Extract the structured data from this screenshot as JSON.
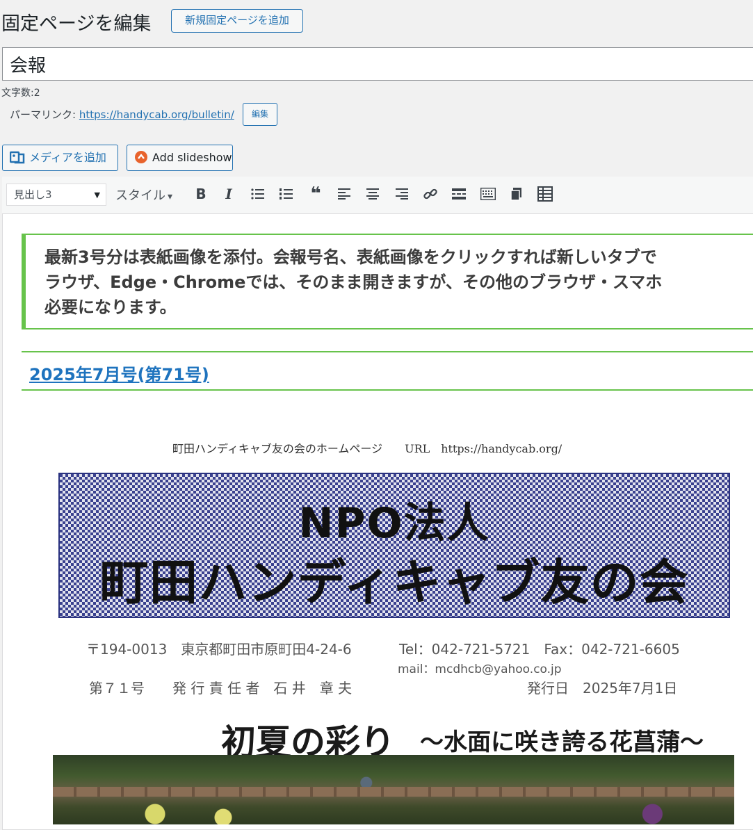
{
  "header": {
    "title": "固定ページを編集",
    "add_new_label": "新規固定ページを追加"
  },
  "post": {
    "title_value": "会報",
    "char_count": "文字数:2",
    "permalink_label": "パーマリンク:",
    "permalink_url": "https://handycab.org/bulletin/",
    "permalink_edit_label": "編集"
  },
  "media_buttons": {
    "add_media": "メディアを追加",
    "add_slideshow": "Add slideshow"
  },
  "toolbar": {
    "format_value": "見出し3",
    "styles_label": "スタイル",
    "styles_caret": "▾",
    "format_caret": "▼",
    "buttons": [
      {
        "name": "bold-button",
        "glyph": "B"
      },
      {
        "name": "italic-button",
        "glyph": "I"
      },
      {
        "name": "bullet-list-button",
        "icon": "bullet-list-icon"
      },
      {
        "name": "numbered-list-button",
        "icon": "numbered-list-icon"
      },
      {
        "name": "blockquote-button",
        "glyph": "❝"
      },
      {
        "name": "align-left-button",
        "icon": "align-left-icon"
      },
      {
        "name": "align-center-button",
        "icon": "align-center-icon"
      },
      {
        "name": "align-right-button",
        "icon": "align-right-icon"
      },
      {
        "name": "link-button",
        "icon": "link-icon"
      },
      {
        "name": "read-more-button",
        "icon": "read-more-icon"
      },
      {
        "name": "toolbar-toggle-button",
        "icon": "keyboard-icon"
      },
      {
        "name": "copy-button",
        "icon": "copy-icon"
      },
      {
        "name": "table-button",
        "icon": "table-icon"
      }
    ]
  },
  "content": {
    "notice_text": "最新3号分は表紙画像を添付。会報号名、表紙画像をクリックすれば新しいタブで\nラウザ、Edge・Chromeでは、そのまま開きますが、その他のブラウザ・スマホ\n必要になります。",
    "issue_link": "2025年7月号(第71号)"
  },
  "cover": {
    "header_line": "町田ハンディキャブ友の会のホームページ　　URL　https://handycab.org/",
    "masthead_line1": "NPO法人",
    "masthead_line2": "町田ハンディキャブ友の会",
    "address": "〒194-0013　東京都町田市原町田4-24-6",
    "tel_fax": "Tel：042-721-5721　Fax：042-721-6605",
    "mail": "mail：mcdhcb@yahoo.co.jp",
    "issue_no": "第７１号　　発 行 責 任 者　石 井　章 夫",
    "issue_date": "発行日　2025年7月1日",
    "feature_title": "初夏の彩り",
    "feature_subtitle": "～水面に咲き誇る花菖蒲～"
  },
  "colors": {
    "accent": "#2271b1",
    "notice_border": "#67c34b",
    "link": "#1e73be",
    "masthead_blue": "#3a418f"
  }
}
